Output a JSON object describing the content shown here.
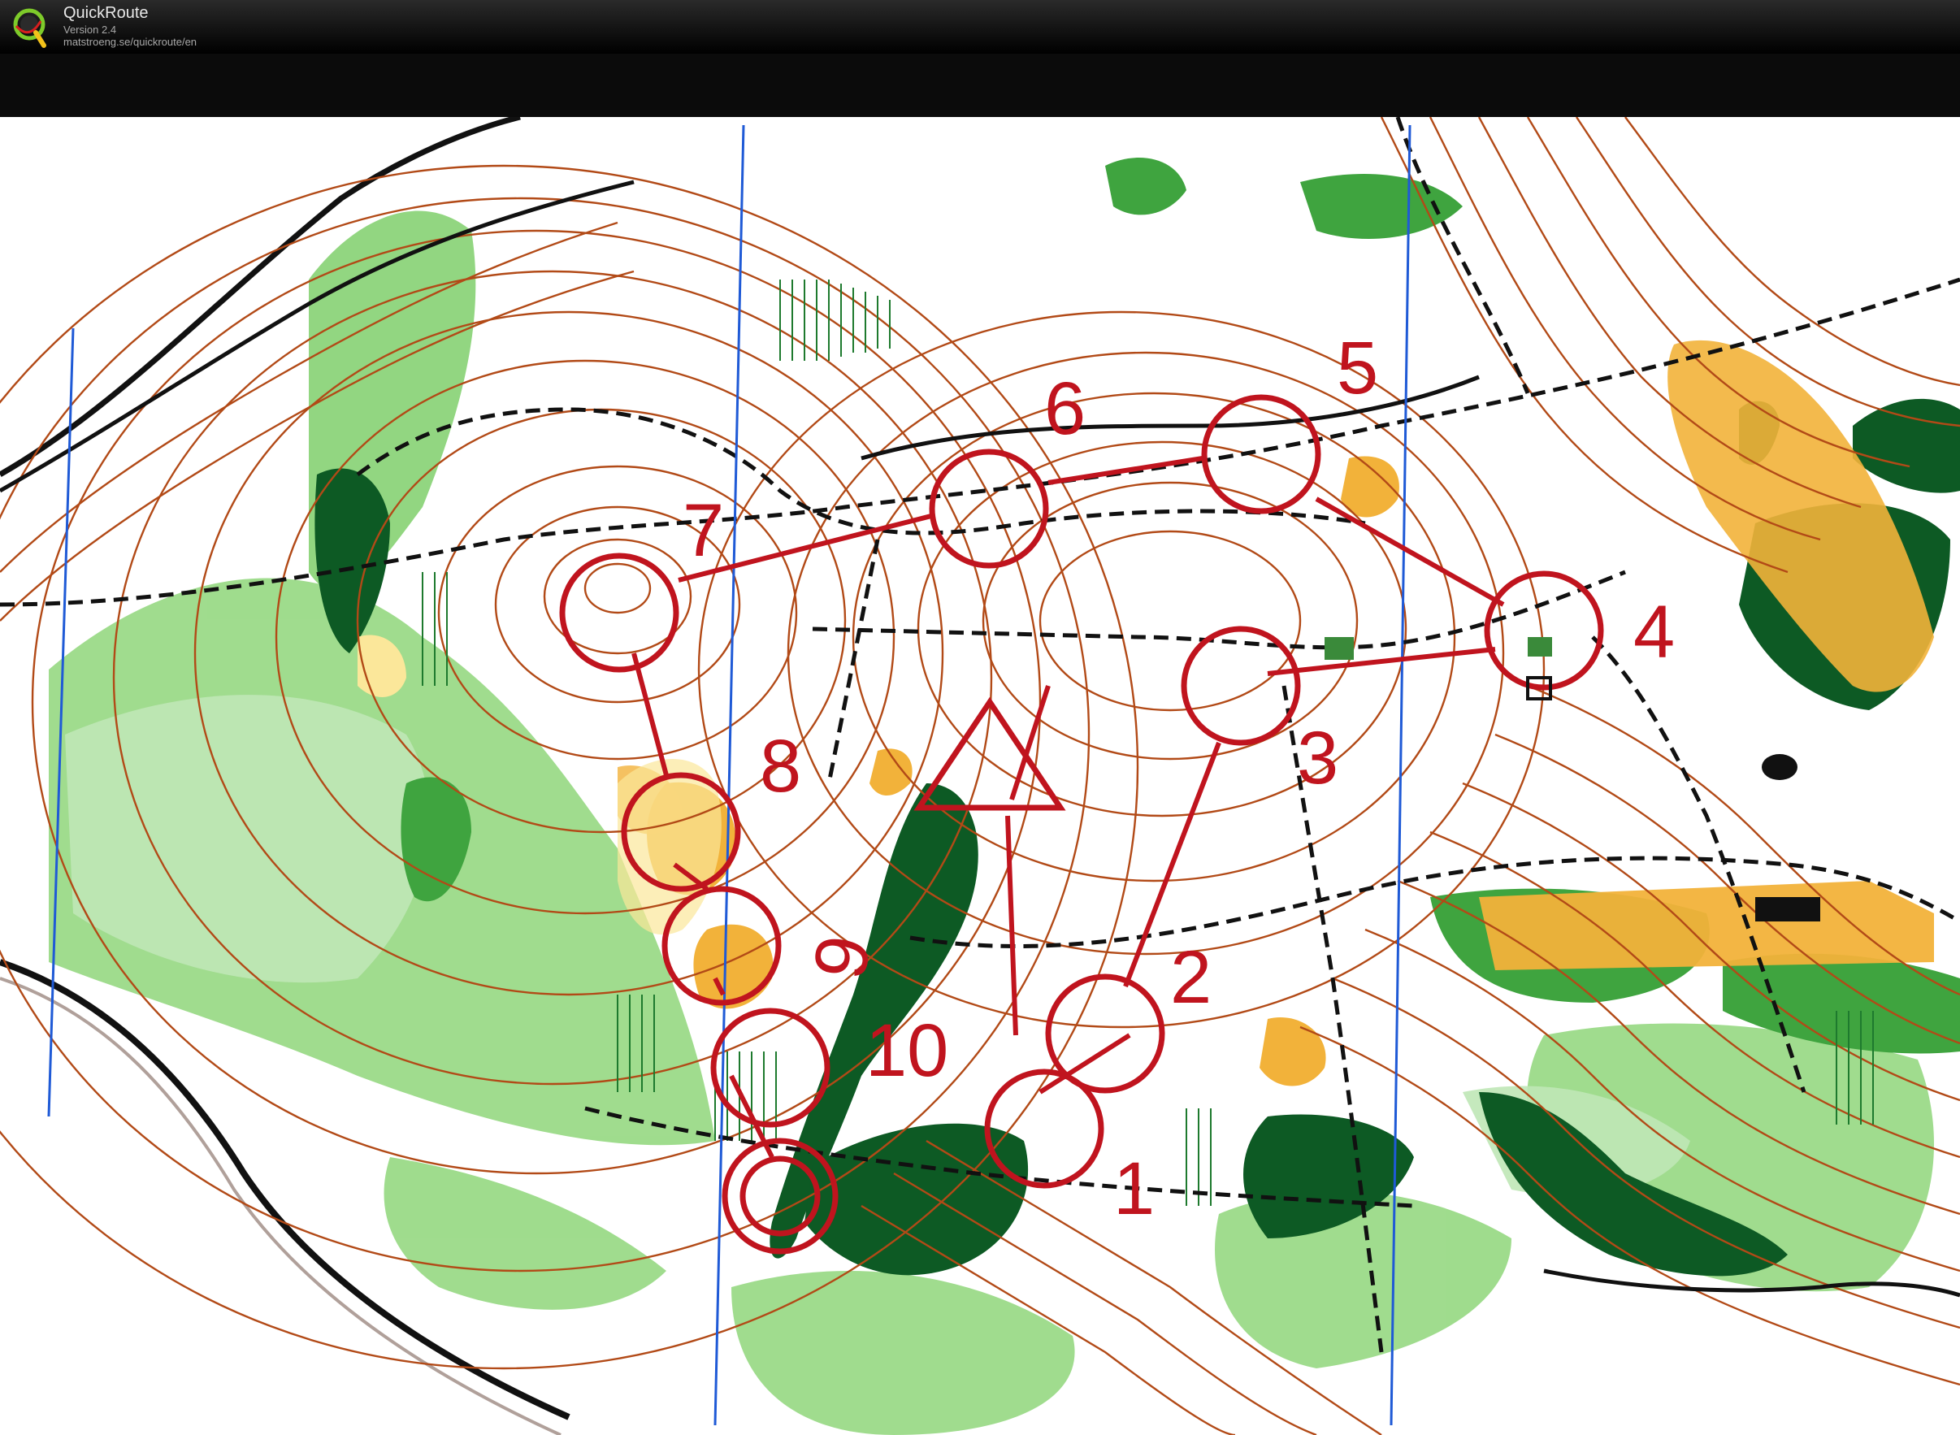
{
  "app": {
    "name": "QuickRoute",
    "version": "Version 2.4",
    "url": "matstroeng.se/quickroute/en",
    "logo_letter": "Q"
  },
  "map": {
    "type": "orienteering-map",
    "course": {
      "start_symbol": "triangle",
      "finish_symbol": "double-circle",
      "controls": [
        "1",
        "2",
        "3",
        "4",
        "5",
        "6",
        "7",
        "8",
        "9",
        "10"
      ]
    },
    "colors": {
      "course": "#c0141e",
      "contour": "#b24a17",
      "forest_green": "#6cc25a",
      "dense_green": "#0d5a24",
      "open_yellow": "#f2b23a",
      "north_line": "#1f5ad6",
      "path_black": "#111111",
      "paper": "#ffffff"
    }
  }
}
